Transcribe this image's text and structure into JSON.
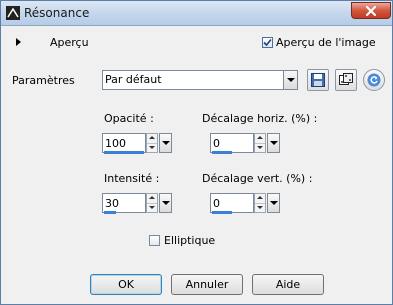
{
  "window": {
    "title": "Résonance"
  },
  "preview": {
    "label": "Aperçu",
    "checkbox_label": "Aperçu de l'image",
    "checkbox_checked": true
  },
  "params": {
    "label": "Paramètres",
    "preset_value": "Par défaut"
  },
  "fields": {
    "opacity": {
      "label": "Opacité :",
      "value": "100",
      "fill": 1.0
    },
    "hoffset": {
      "label": "Décalage horiz. (%) :",
      "value": "0",
      "fill": 0.5
    },
    "intensity": {
      "label": "Intensité :",
      "value": "30",
      "fill": 0.3
    },
    "voffset": {
      "label": "Décalage vert. (%) :",
      "value": "0",
      "fill": 0.5
    }
  },
  "elliptic": {
    "label": "Elliptique",
    "checked": false
  },
  "buttons": {
    "ok": "OK",
    "cancel": "Annuler",
    "help": "Aide"
  },
  "colors": {
    "accent": "#3d7fd6",
    "dialog_bg": "#f0f0f0"
  },
  "icons": [
    "app-icon",
    "close-icon",
    "expand-arrow-icon",
    "save-preset-icon",
    "dice-random-icon",
    "reset-icon"
  ]
}
